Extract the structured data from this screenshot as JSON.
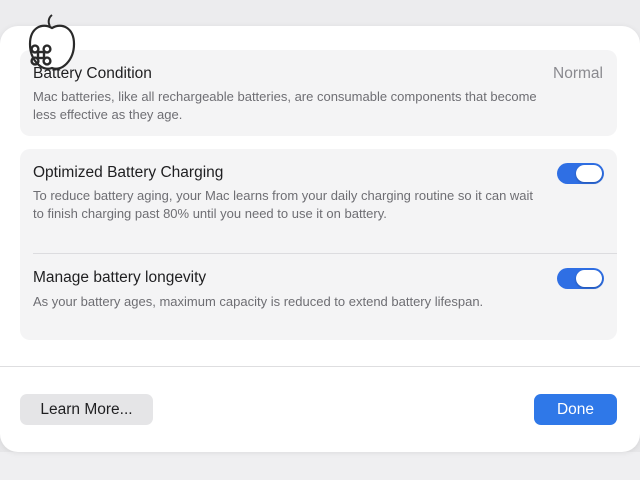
{
  "battery_condition": {
    "title": "Battery Condition",
    "status": "Normal",
    "description": "Mac batteries, like all rechargeable batteries, are consumable components that become less effective as they age."
  },
  "optimized_charging": {
    "title": "Optimized Battery Charging",
    "description": "To reduce battery aging, your Mac learns from your daily charging routine so it can wait to finish charging past 80% until you need to use it on battery.",
    "enabled": true
  },
  "battery_longevity": {
    "title": "Manage battery longevity",
    "description": "As your battery ages, maximum capacity is reduced to extend battery lifespan.",
    "enabled": true
  },
  "buttons": {
    "learn_more": "Learn More...",
    "done": "Done"
  },
  "colors": {
    "accent": "#2f78e8",
    "toggle_on": "#2f6fe4"
  },
  "icons": {
    "logo": "apple-command-logo-icon"
  }
}
